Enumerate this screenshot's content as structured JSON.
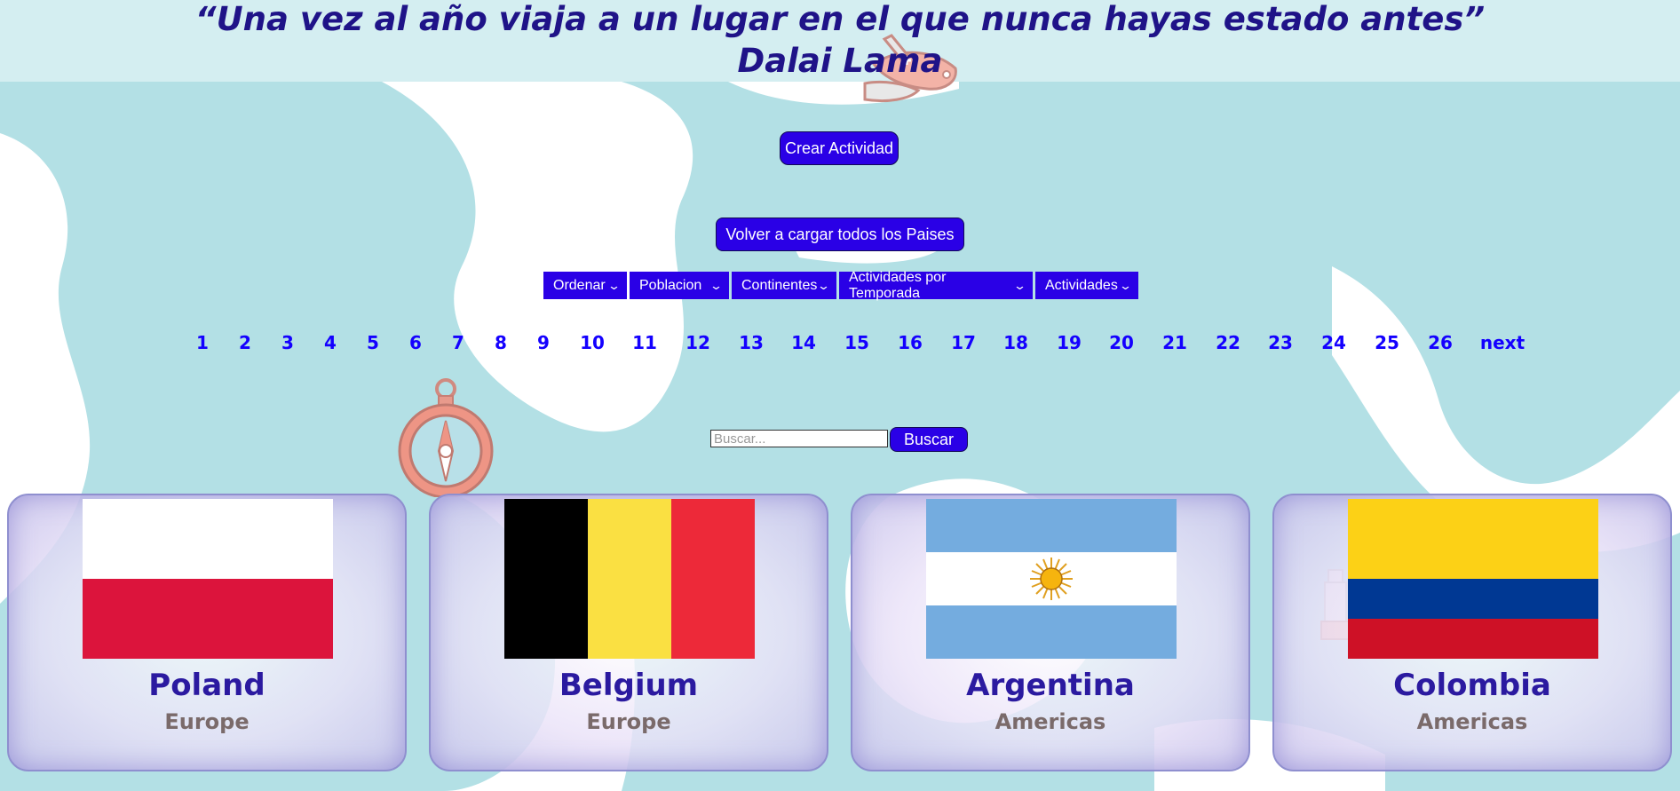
{
  "quote": {
    "text": "“Una vez al año viaja a un lugar en el que nunca hayas estado antes”",
    "author": "Dalai Lama"
  },
  "buttons": {
    "create_activity": "Crear Actividad",
    "reload_all": "Volver a cargar todos los Paises",
    "search": "Buscar"
  },
  "filters": [
    {
      "label": "Ordenar"
    },
    {
      "label": "Poblacion"
    },
    {
      "label": "Continentes"
    },
    {
      "label": "Actividades por Temporada"
    },
    {
      "label": "Actividades"
    }
  ],
  "pagination": {
    "pages": [
      "1",
      "2",
      "3",
      "4",
      "5",
      "6",
      "7",
      "8",
      "9",
      "10",
      "11",
      "12",
      "13",
      "14",
      "15",
      "16",
      "17",
      "18",
      "19",
      "20",
      "21",
      "22",
      "23",
      "24",
      "25",
      "26"
    ],
    "next_label": "next"
  },
  "search": {
    "placeholder": "Buscar...",
    "value": ""
  },
  "cards": [
    {
      "name": "Poland",
      "continent": "Europe"
    },
    {
      "name": "Belgium",
      "continent": "Europe"
    },
    {
      "name": "Argentina",
      "continent": "Americas"
    },
    {
      "name": "Colombia",
      "continent": "Americas"
    }
  ],
  "colors": {
    "accent": "#2a00e6",
    "title_text": "#1f1388",
    "page_link": "#1400ff",
    "map_land": "#b3e0e5"
  },
  "icons": [
    "swiss-knife-icon",
    "compass-icon",
    "chevron-down-icon",
    "chess-piece-icon"
  ]
}
